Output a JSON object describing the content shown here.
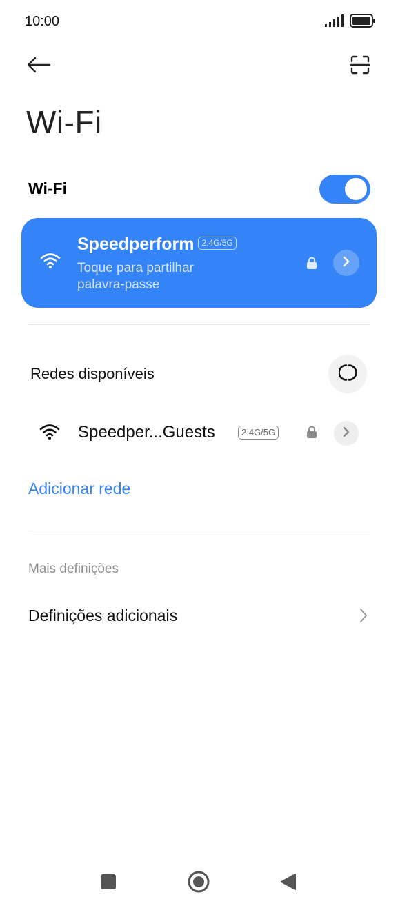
{
  "status_bar": {
    "time": "10:00",
    "signal_icon": "signal-bars-icon",
    "battery_icon": "battery-full-icon"
  },
  "top_bar": {
    "back_icon": "arrow-left-icon",
    "scan_icon": "qr-scan-icon"
  },
  "page": {
    "title": "Wi-Fi"
  },
  "wifi_toggle": {
    "label": "Wi-Fi",
    "state": "on",
    "accent_color": "#3483f7"
  },
  "connected_network": {
    "ssid": "Speedperform",
    "band": "2.4G/5G",
    "subtitle": "Toque para partilhar palavra-passe",
    "secured": true
  },
  "available_networks": {
    "heading": "Redes disponíveis",
    "refresh_icon": "refresh-icon",
    "items": [
      {
        "ssid": "Speedper...Guests",
        "band": "2.4G/5G",
        "secured": true
      }
    ],
    "add_network_label": "Adicionar rede"
  },
  "more_settings": {
    "section_label": "Mais definições",
    "additional_label": "Definições adicionais"
  },
  "nav_bar": {
    "recents_icon": "square-icon",
    "home_icon": "circle-home-icon",
    "back_icon": "triangle-back-icon"
  }
}
